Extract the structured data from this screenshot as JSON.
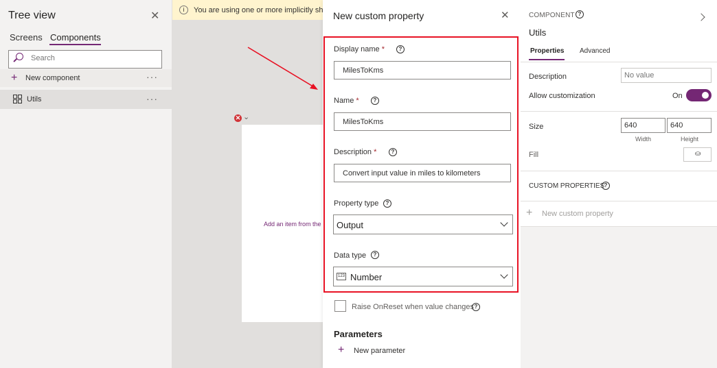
{
  "tree_view": {
    "title": "Tree view",
    "tabs": [
      "Screens",
      "Components"
    ],
    "search_placeholder": "Search",
    "new_component_label": "New component",
    "items": [
      {
        "label": "Utils"
      }
    ],
    "more": "···"
  },
  "canvas": {
    "banner_text": "You are using one or more implicitly shared connections",
    "add_item_text": "Add an item from the Insert pane"
  },
  "dialog": {
    "title": "New custom property",
    "display_name_label": "Display name",
    "display_name_value": "MilesToKms",
    "name_label": "Name",
    "name_value": "MilesToKms",
    "description_label": "Description",
    "description_value": "Convert input value in miles to kilometers",
    "required_mark": "*",
    "property_type_label": "Property type",
    "property_type_value": "Output",
    "data_type_label": "Data type",
    "data_type_value": "Number",
    "raise_onreset_label": "Raise OnReset when value changes",
    "parameters_title": "Parameters",
    "new_parameter_label": "New parameter"
  },
  "properties_panel": {
    "kind_label": "COMPONENT",
    "component_name": "Utils",
    "tabs": [
      "Properties",
      "Advanced"
    ],
    "description_label": "Description",
    "description_placeholder": "No value",
    "allow_customization_label": "Allow customization",
    "allow_customization_state": "On",
    "size_label": "Size",
    "width_value": "640",
    "height_value": "640",
    "width_label": "Width",
    "height_label": "Height",
    "fill_label": "Fill",
    "custom_properties_label": "CUSTOM PROPERTIES",
    "new_custom_property_label": "New custom property"
  },
  "colors": {
    "accent": "#742774",
    "highlight_box": "#e81123",
    "banner": "#fff4ce",
    "canvas_bg": "#e1dfdd"
  },
  "icons": {
    "close": "close-icon",
    "search": "search-icon",
    "add": "plus-icon",
    "component": "component-icon",
    "info": "info-icon",
    "help": "help-icon",
    "error": "error-icon",
    "dropdown": "chevron-down-icon",
    "number": "number-type-icon",
    "fill": "paint-bucket-icon"
  }
}
